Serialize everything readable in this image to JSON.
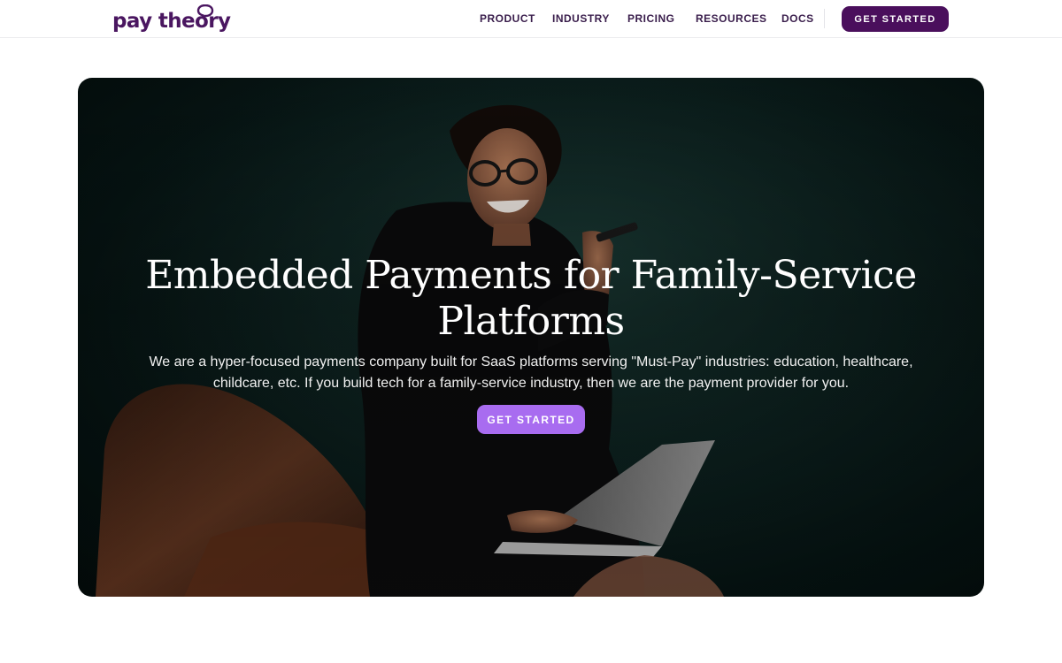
{
  "brand": {
    "name": "pay theory",
    "color": "#4a1660"
  },
  "nav": {
    "items": [
      {
        "label": "PRODUCT"
      },
      {
        "label": "INDUSTRY"
      },
      {
        "label": "PRICING"
      },
      {
        "label": "RESOURCES"
      },
      {
        "label": "DOCS"
      }
    ],
    "cta_label": "GET STARTED",
    "cta_color": "#4a0f5c"
  },
  "hero": {
    "title": "Embedded Payments for Family-Service Platforms",
    "subtitle": "We are a hyper-focused payments company built for SaaS platforms serving \"Must-Pay\" industries: education, healthcare, childcare, etc. If you build tech for a family-service industry, then we are the payment provider for you.",
    "cta_label": "GET STARTED",
    "cta_color": "#a86cf0",
    "background_image": "woman-laughing-on-phone-with-laptop-photo"
  }
}
